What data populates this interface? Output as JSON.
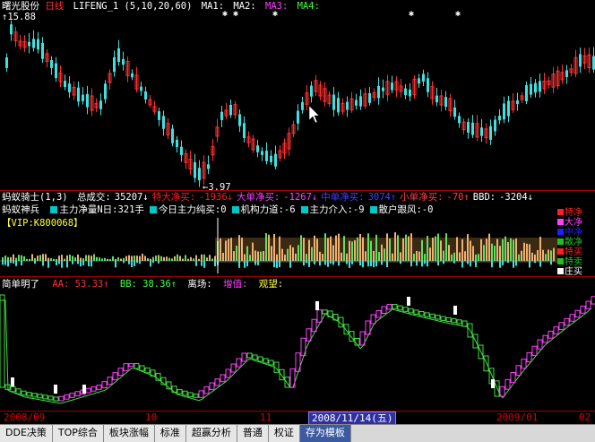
{
  "main_panel": {
    "stock_name": "曙光股份",
    "period": "日线",
    "indicator": "LIFENG_1 (5,10,20,60)",
    "ma1": "MA1:",
    "ma2": "MA2:",
    "ma3": "MA3:",
    "ma4": "MA4:",
    "high_price": "15.88",
    "low_price": "3.97",
    "colors": {
      "up": "#ff3030",
      "down": "#40e0e0"
    }
  },
  "ant_panel": {
    "title": "蚂蚁骑士(1,3)",
    "items": [
      {
        "label": "总成交:",
        "value": "35207↓",
        "color": "#ffffff"
      },
      {
        "label": "特大净买:",
        "value": "-1936↓",
        "color": "#ff2020"
      },
      {
        "label": "大单净买:",
        "value": "-1267↓",
        "color": "#ff40ff"
      },
      {
        "label": "中单净买:",
        "value": "3074↑",
        "color": "#4040ff"
      },
      {
        "label": "小单净买:",
        "value": "-70↑",
        "color": "#ff4040"
      },
      {
        "label": "BBD:",
        "value": "-3204↓",
        "color": "#ffffff"
      }
    ],
    "subtitle": "蚂蚁神兵",
    "sub_items": [
      "主力净量N日:321手",
      "今日主力纯买:0",
      "机构力道:-6",
      "主力介入:-9",
      "散户跟风:-0"
    ],
    "vip": "【VIP:K800068】",
    "legend": [
      {
        "label": "特净",
        "color": "#ff2020"
      },
      {
        "label": "大净",
        "color": "#ff40ff"
      },
      {
        "label": "中净",
        "color": "#2020ff"
      },
      {
        "label": "散净",
        "color": "#20c020"
      },
      {
        "label": "特买",
        "color": "#ff2020"
      },
      {
        "label": "特卖",
        "color": "#20c020"
      },
      {
        "label": "庄买",
        "color": "#ffffff"
      }
    ]
  },
  "simple_panel": {
    "title": "简单明了",
    "aa": "AA: 53.33↑",
    "bb": "BB: 38.36↑",
    "exit_label": "离场:",
    "hold_label": "增值:",
    "watch_label": "观望:"
  },
  "date_bar": {
    "left_date": "2008/09",
    "tick_10": "10",
    "tick_11": "11",
    "current": "2008/11/14(五)",
    "right_date": "2009/01",
    "tick_02": "02"
  },
  "tabs": [
    {
      "label": "DDE决策",
      "active": false
    },
    {
      "label": "TOP综合",
      "active": false
    },
    {
      "label": "板块涨幅",
      "active": false
    },
    {
      "label": "标准",
      "active": false
    },
    {
      "label": "超赢分析",
      "active": false
    },
    {
      "label": "普通",
      "active": false
    },
    {
      "label": "权证",
      "active": false
    },
    {
      "label": "存为模板",
      "active": true
    }
  ]
}
